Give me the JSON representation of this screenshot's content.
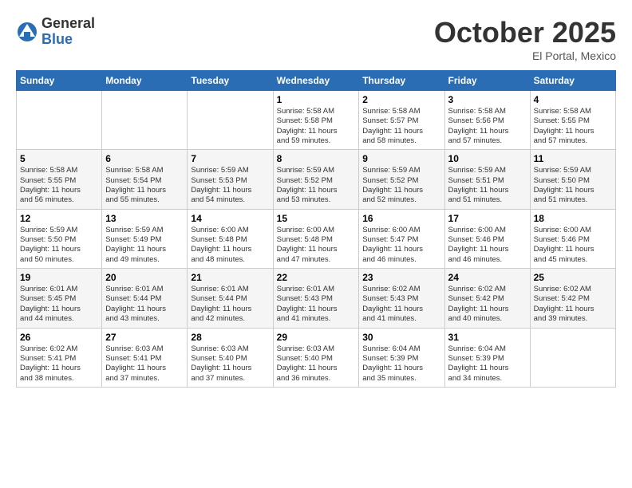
{
  "logo": {
    "general": "General",
    "blue": "Blue"
  },
  "header": {
    "month": "October 2025",
    "location": "El Portal, Mexico"
  },
  "weekdays": [
    "Sunday",
    "Monday",
    "Tuesday",
    "Wednesday",
    "Thursday",
    "Friday",
    "Saturday"
  ],
  "weeks": [
    [
      {
        "day": "",
        "info": ""
      },
      {
        "day": "",
        "info": ""
      },
      {
        "day": "",
        "info": ""
      },
      {
        "day": "1",
        "info": "Sunrise: 5:58 AM\nSunset: 5:58 PM\nDaylight: 11 hours\nand 59 minutes."
      },
      {
        "day": "2",
        "info": "Sunrise: 5:58 AM\nSunset: 5:57 PM\nDaylight: 11 hours\nand 58 minutes."
      },
      {
        "day": "3",
        "info": "Sunrise: 5:58 AM\nSunset: 5:56 PM\nDaylight: 11 hours\nand 57 minutes."
      },
      {
        "day": "4",
        "info": "Sunrise: 5:58 AM\nSunset: 5:55 PM\nDaylight: 11 hours\nand 57 minutes."
      }
    ],
    [
      {
        "day": "5",
        "info": "Sunrise: 5:58 AM\nSunset: 5:55 PM\nDaylight: 11 hours\nand 56 minutes."
      },
      {
        "day": "6",
        "info": "Sunrise: 5:58 AM\nSunset: 5:54 PM\nDaylight: 11 hours\nand 55 minutes."
      },
      {
        "day": "7",
        "info": "Sunrise: 5:59 AM\nSunset: 5:53 PM\nDaylight: 11 hours\nand 54 minutes."
      },
      {
        "day": "8",
        "info": "Sunrise: 5:59 AM\nSunset: 5:52 PM\nDaylight: 11 hours\nand 53 minutes."
      },
      {
        "day": "9",
        "info": "Sunrise: 5:59 AM\nSunset: 5:52 PM\nDaylight: 11 hours\nand 52 minutes."
      },
      {
        "day": "10",
        "info": "Sunrise: 5:59 AM\nSunset: 5:51 PM\nDaylight: 11 hours\nand 51 minutes."
      },
      {
        "day": "11",
        "info": "Sunrise: 5:59 AM\nSunset: 5:50 PM\nDaylight: 11 hours\nand 51 minutes."
      }
    ],
    [
      {
        "day": "12",
        "info": "Sunrise: 5:59 AM\nSunset: 5:50 PM\nDaylight: 11 hours\nand 50 minutes."
      },
      {
        "day": "13",
        "info": "Sunrise: 5:59 AM\nSunset: 5:49 PM\nDaylight: 11 hours\nand 49 minutes."
      },
      {
        "day": "14",
        "info": "Sunrise: 6:00 AM\nSunset: 5:48 PM\nDaylight: 11 hours\nand 48 minutes."
      },
      {
        "day": "15",
        "info": "Sunrise: 6:00 AM\nSunset: 5:48 PM\nDaylight: 11 hours\nand 47 minutes."
      },
      {
        "day": "16",
        "info": "Sunrise: 6:00 AM\nSunset: 5:47 PM\nDaylight: 11 hours\nand 46 minutes."
      },
      {
        "day": "17",
        "info": "Sunrise: 6:00 AM\nSunset: 5:46 PM\nDaylight: 11 hours\nand 46 minutes."
      },
      {
        "day": "18",
        "info": "Sunrise: 6:00 AM\nSunset: 5:46 PM\nDaylight: 11 hours\nand 45 minutes."
      }
    ],
    [
      {
        "day": "19",
        "info": "Sunrise: 6:01 AM\nSunset: 5:45 PM\nDaylight: 11 hours\nand 44 minutes."
      },
      {
        "day": "20",
        "info": "Sunrise: 6:01 AM\nSunset: 5:44 PM\nDaylight: 11 hours\nand 43 minutes."
      },
      {
        "day": "21",
        "info": "Sunrise: 6:01 AM\nSunset: 5:44 PM\nDaylight: 11 hours\nand 42 minutes."
      },
      {
        "day": "22",
        "info": "Sunrise: 6:01 AM\nSunset: 5:43 PM\nDaylight: 11 hours\nand 41 minutes."
      },
      {
        "day": "23",
        "info": "Sunrise: 6:02 AM\nSunset: 5:43 PM\nDaylight: 11 hours\nand 41 minutes."
      },
      {
        "day": "24",
        "info": "Sunrise: 6:02 AM\nSunset: 5:42 PM\nDaylight: 11 hours\nand 40 minutes."
      },
      {
        "day": "25",
        "info": "Sunrise: 6:02 AM\nSunset: 5:42 PM\nDaylight: 11 hours\nand 39 minutes."
      }
    ],
    [
      {
        "day": "26",
        "info": "Sunrise: 6:02 AM\nSunset: 5:41 PM\nDaylight: 11 hours\nand 38 minutes."
      },
      {
        "day": "27",
        "info": "Sunrise: 6:03 AM\nSunset: 5:41 PM\nDaylight: 11 hours\nand 37 minutes."
      },
      {
        "day": "28",
        "info": "Sunrise: 6:03 AM\nSunset: 5:40 PM\nDaylight: 11 hours\nand 37 minutes."
      },
      {
        "day": "29",
        "info": "Sunrise: 6:03 AM\nSunset: 5:40 PM\nDaylight: 11 hours\nand 36 minutes."
      },
      {
        "day": "30",
        "info": "Sunrise: 6:04 AM\nSunset: 5:39 PM\nDaylight: 11 hours\nand 35 minutes."
      },
      {
        "day": "31",
        "info": "Sunrise: 6:04 AM\nSunset: 5:39 PM\nDaylight: 11 hours\nand 34 minutes."
      },
      {
        "day": "",
        "info": ""
      }
    ]
  ]
}
